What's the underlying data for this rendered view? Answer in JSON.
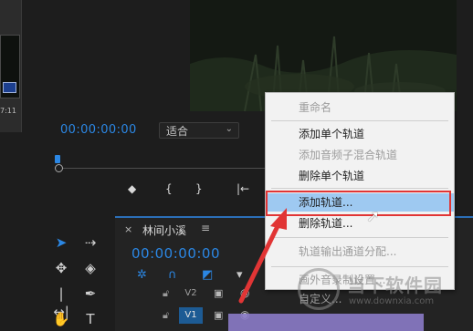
{
  "thumbnail": {
    "time_label": "7:11"
  },
  "program_monitor": {
    "timecode": "00:00:00:00",
    "fit_select": {
      "value": "适合",
      "chevron_icon": "chevron-down-icon"
    },
    "transport_icons": [
      "add-marker-icon",
      "mark-in-icon",
      "mark-out-icon",
      "go-to-in-icon"
    ]
  },
  "timeline": {
    "close_icon": "close-icon",
    "title": "林间小溪",
    "menu_icon": "hamburger-icon",
    "timecode": "00:00:00:00",
    "tools": [
      "nest-icon",
      "snap-icon",
      "linked-selection-icon",
      "marker-icon",
      "settings-icon"
    ],
    "tracks": [
      {
        "name": "V2",
        "active": false
      },
      {
        "name": "V1",
        "active": true
      }
    ]
  },
  "tools_panel": {
    "items": [
      "selection-tool-icon",
      "track-select-forward-icon",
      "ripple-edit-icon",
      "razor-icon",
      "slip-icon",
      "pen-icon",
      "hand-icon",
      "type-icon"
    ]
  },
  "context_menu": {
    "items": [
      {
        "label": "重命名",
        "disabled": true
      },
      {
        "label": "添加单个轨道",
        "disabled": false
      },
      {
        "label": "添加音频子混合轨道",
        "disabled": true
      },
      {
        "label": "删除单个轨道",
        "disabled": false
      },
      {
        "label": "添加轨道...",
        "disabled": false,
        "highlighted": true
      },
      {
        "label": "删除轨道...",
        "disabled": false
      },
      {
        "label": "轨道输出通道分配...",
        "disabled": true
      },
      {
        "label": "画外音录制设置...",
        "disabled": true
      },
      {
        "label": "自定义...",
        "disabled": true
      }
    ]
  },
  "annotation": {
    "highlight_color": "#e13535",
    "arrow_color": "#e13535"
  },
  "watermark": {
    "text": "当下软件园",
    "url": "www.downxia.com"
  },
  "colors": {
    "accent": "#2b87e4",
    "track_active": "#1d5b94",
    "menu_highlight": "#9ec9f1"
  }
}
